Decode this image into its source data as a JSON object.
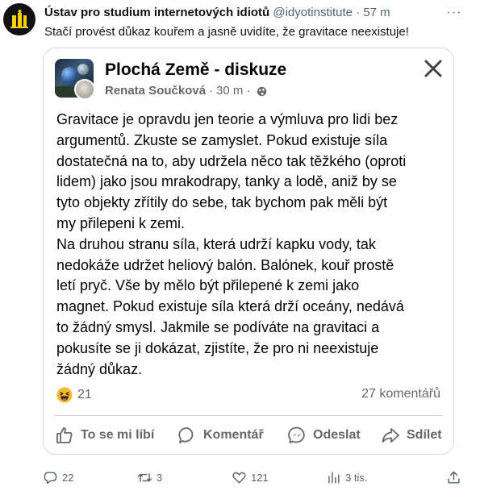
{
  "tweet": {
    "author_name": "Ústav pro studium internetových idiotů",
    "author_handle": "@idyotinstitute",
    "separator": "·",
    "time": "57 m",
    "more_label": "···",
    "text": "Stačí provést důkaz kouřem a jasně uvidíte, že gravitace neexistuje!",
    "stats": {
      "replies": "22",
      "retweets": "3",
      "likes": "121",
      "views": "3 tis."
    }
  },
  "embedded_post": {
    "group_name": "Plochá Země - diskuze",
    "poster_name": "Renata Součková",
    "separator": "·",
    "time": "30 m",
    "meta_separator": "·",
    "body_lines": [
      "Gravitace je opravdu jen teorie a výmluva pro lidi bez",
      "argumentů. Zkuste se zamyslet. Pokud existuje síla",
      "dostatečná na to, aby udržela něco tak těžkého (oproti",
      "lidem) jako jsou mrakodrapy, tanky a lodě, aniž by se",
      "tyto objekty zřítily do sebe, tak bychom pak měli být",
      "my přilepeni k zemi.",
      "Na druhou stranu síla, která udrží kapku vody, tak",
      "nedokáže udržet heliový balón. Balónek, kouř prostě",
      "letí pryč. Vše by mělo být přilepené k zemi jako",
      "magnet. Pokud existuje síla která drží oceány, nedává",
      "to žádný smysl. Jakmile se podíváte na gravitaci a",
      "pokusíte se ji dokázat, zjistíte, že pro ni neexistuje",
      "žádný důkaz."
    ],
    "reaction_count": "21",
    "comments_label": "27 komentářů",
    "actions": {
      "like": "To se mi líbí",
      "comment": "Komentář",
      "send": "Odeslat",
      "share": "Sdílet"
    }
  },
  "icons": {
    "avatar": "idiot-institute-logo-icon",
    "reaction": "haha-emoji-icon",
    "privacy": "globe-icon",
    "close": "close-icon"
  },
  "colors": {
    "text_primary": "#0f1419",
    "text_secondary": "#536471",
    "fb_secondary": "#65676b",
    "border": "#cfd9de",
    "haha_yellow": "#f7b928"
  }
}
